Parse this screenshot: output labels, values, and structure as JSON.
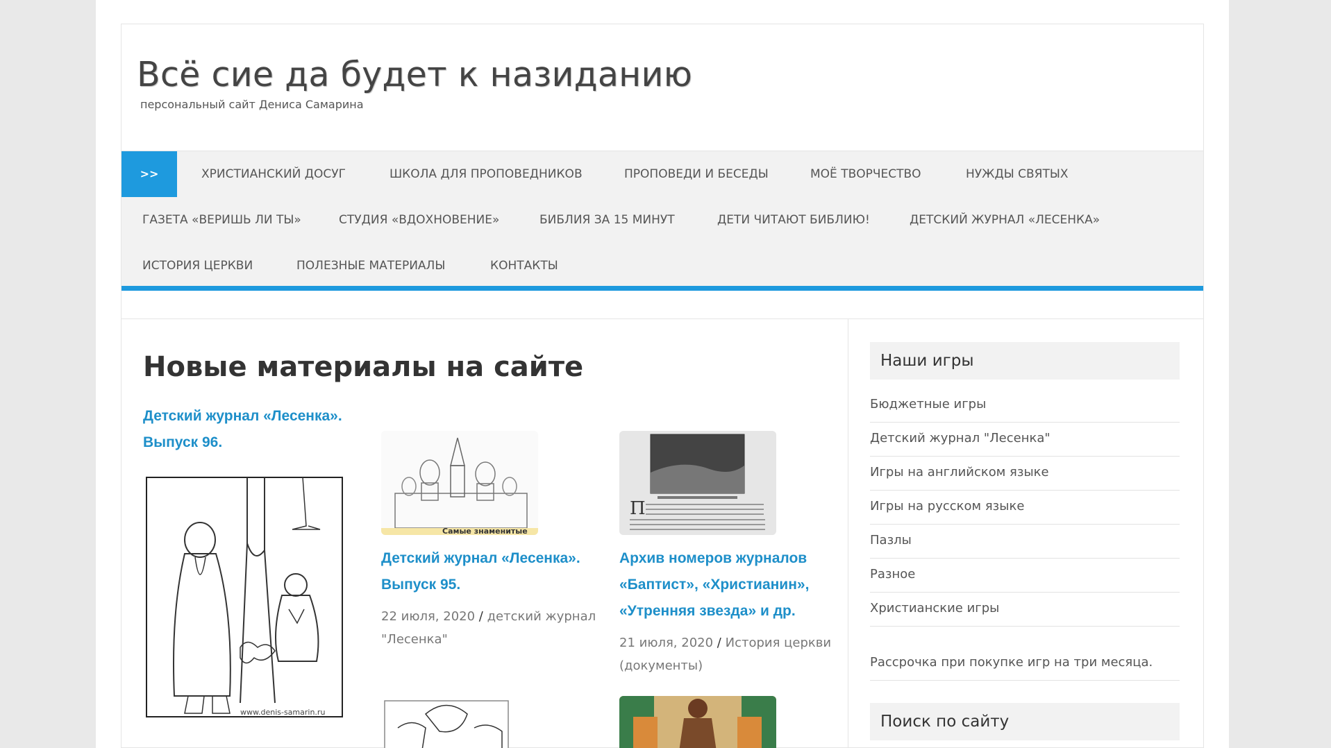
{
  "site": {
    "title": "Всё сие да будет к назиданию",
    "description": "персональный сайт Дениса Самарина"
  },
  "nav": {
    "home_label": ">>",
    "items": [
      {
        "label": "ХРИСТИАНСКИЙ ДОСУГ"
      },
      {
        "label": "ШКОЛА ДЛЯ ПРОПОВЕДНИКОВ"
      },
      {
        "label": "ПРОПОВЕДИ И БЕСЕДЫ"
      },
      {
        "label": "МОЁ ТВОРЧЕСТВО"
      },
      {
        "label": "НУЖДЫ СВЯТЫХ"
      },
      {
        "label": "ГАЗЕТА «ВЕРИШЬ ЛИ ТЫ»"
      },
      {
        "label": "СТУДИЯ «ВДОХНОВЕНИЕ»"
      },
      {
        "label": "БИБЛИЯ ЗА 15 МИНУТ"
      },
      {
        "label": "ДЕТИ ЧИТАЮТ БИБЛИЮ!"
      },
      {
        "label": "ДЕТСКИЙ ЖУРНАЛ «ЛЕСЕНКА»"
      },
      {
        "label": "ИСТОРИЯ ЦЕРКВИ"
      },
      {
        "label": "ПОЛЕЗНЫЕ МАТЕРИАЛЫ"
      },
      {
        "label": "КОНТАКТЫ"
      }
    ]
  },
  "main": {
    "section_title": "Новые материалы на сайте",
    "posts": [
      {
        "title_line1": "Детский журнал «Лесенка».",
        "title_line2": "Выпуск 96.",
        "image_caption": "www.denis-samarin.ru"
      },
      {
        "title_line1": "Детский журнал «Лесенка».",
        "title_line2": "Выпуск 95.",
        "date": "22 июля, 2020",
        "separator": "/",
        "category_line1": "детский журнал",
        "category_line2": "\"Лесенка\"",
        "image_caption": "Самые знаменитые"
      },
      {
        "title_line1": "Архив номеров журналов",
        "title_line2": "«Баптист», «Христианин»,",
        "title_line3": "«Утренняя звезда» и др.",
        "date": "21 июля, 2020",
        "separator": "/",
        "category_line1": "История церкви",
        "category_line2": "(документы)"
      }
    ]
  },
  "sidebar": {
    "games_title": "Наши игры",
    "games": [
      {
        "label": "Бюджетные игры"
      },
      {
        "label": "Детский журнал \"Лесенка\""
      },
      {
        "label": "Игры на английском языке"
      },
      {
        "label": "Игры на русском языке"
      },
      {
        "label": "Пазлы"
      },
      {
        "label": "Разное"
      },
      {
        "label": "Христианские игры"
      }
    ],
    "installment_note": "Рассрочка при покупке игр на три месяца.",
    "search_title": "Поиск по сайту"
  },
  "colors": {
    "accent": "#1e9ade",
    "link": "#1e8fc9",
    "nav_bg": "#f2f2f2"
  }
}
